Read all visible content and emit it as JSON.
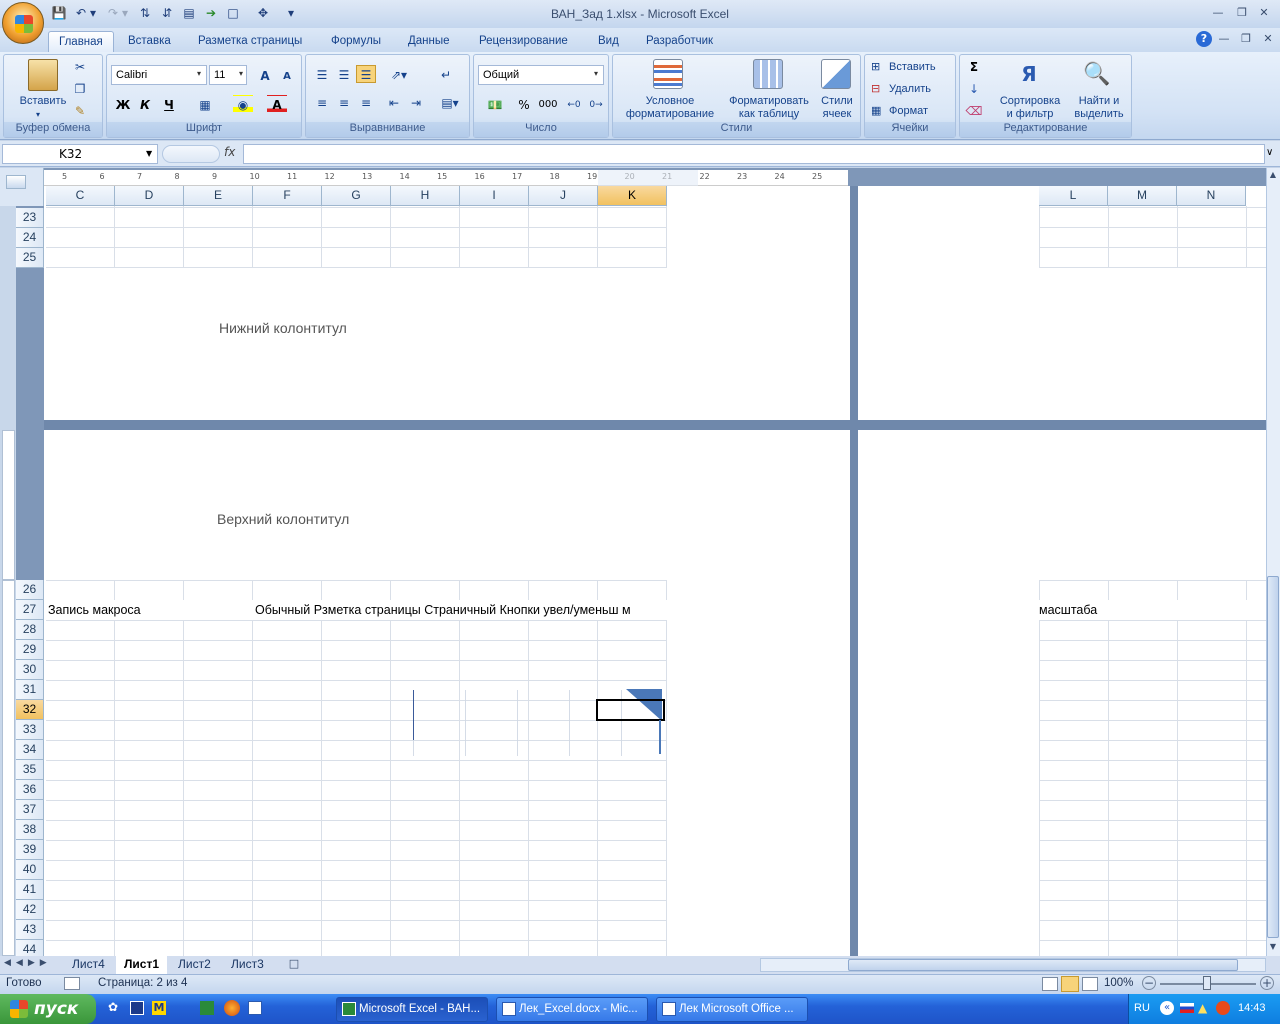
{
  "window": {
    "title": "ВАН_Зад 1.xlsx - Microsoft Excel"
  },
  "tabs": [
    "Главная",
    "Вставка",
    "Разметка страницы",
    "Формулы",
    "Данные",
    "Рецензирование",
    "Вид",
    "Разработчик"
  ],
  "ribbon": {
    "clipboard": {
      "paste": "Вставить",
      "label": "Буфер обмена"
    },
    "font": {
      "name": "Calibri",
      "size": "11",
      "bold": "Ж",
      "italic": "К",
      "underline": "Ч",
      "label": "Шрифт"
    },
    "alignment": {
      "label": "Выравнивание"
    },
    "number": {
      "format": "Общий",
      "percent": "%",
      "thousands": "000",
      "label": "Число"
    },
    "styles": {
      "cond_line1": "Условное",
      "cond_line2": "форматирование",
      "table_line1": "Форматировать",
      "table_line2": "как таблицу",
      "cell_line1": "Стили",
      "cell_line2": "ячеек",
      "label": "Стили"
    },
    "cells": {
      "insert": "Вставить",
      "delete": "Удалить",
      "format": "Формат",
      "label": "Ячейки"
    },
    "editing": {
      "sort_line1": "Сортировка",
      "sort_line2": "и фильтр",
      "find_line1": "Найти и",
      "find_line2": "выделить",
      "label": "Редактирование"
    }
  },
  "formula_bar": {
    "name_box": "K32",
    "fx": "fx",
    "value": ""
  },
  "ruler": {
    "marks": [
      "5",
      "6",
      "7",
      "8",
      "9",
      "10",
      "11",
      "12",
      "13",
      "14",
      "15",
      "16",
      "17",
      "18",
      "19",
      "20",
      "21",
      "22",
      "23",
      "24",
      "25"
    ]
  },
  "columns_left": [
    "C",
    "D",
    "E",
    "F",
    "G",
    "H",
    "I",
    "J",
    "K"
  ],
  "columns_right": [
    "L",
    "M",
    "N"
  ],
  "selected_column": "K",
  "rows_top": [
    "23",
    "24",
    "25"
  ],
  "rows_bottom": [
    "26",
    "27",
    "28",
    "29",
    "30",
    "31",
    "32",
    "33",
    "34",
    "35",
    "36",
    "37",
    "38",
    "39",
    "40",
    "41",
    "42",
    "43",
    "44"
  ],
  "selected_row": "32",
  "footer_text": "Нижний колонтитул",
  "header_text": "Верхний колонтитул",
  "cells": {
    "row27_c": "Запись макроса",
    "row27_f": "Обычный Рзметка страницы Страничный Кнопки увел/уменьш м",
    "row27_l": "масштаба"
  },
  "sheet_tabs": [
    "Лист4",
    "Лист1",
    "Лист2",
    "Лист3"
  ],
  "active_sheet": "Лист1",
  "status": {
    "ready": "Готово",
    "page": "Страница: 2 из 4",
    "zoom": "100%"
  },
  "taskbar": {
    "start": "пуск",
    "windows": [
      "Microsoft Excel - ВАН...",
      "Лек_Excel.docx - Mic...",
      "Лек Microsoft Office ..."
    ],
    "lang": "RU",
    "time": "14:43"
  }
}
